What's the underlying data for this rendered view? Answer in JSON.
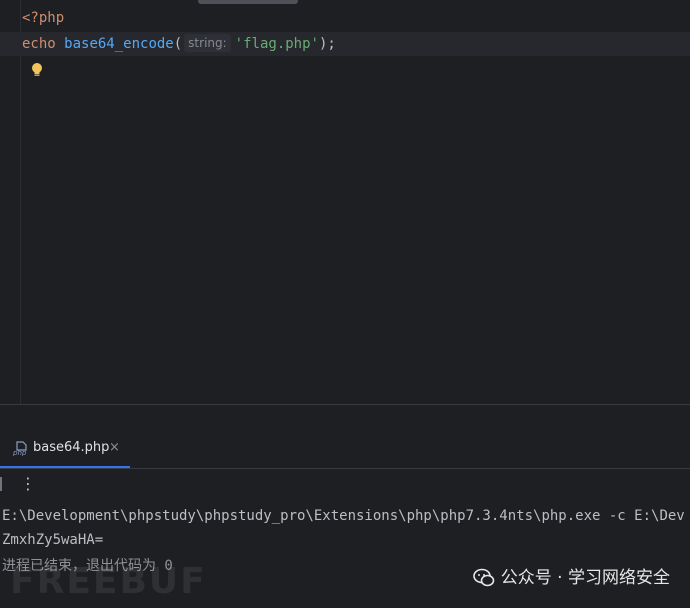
{
  "editor": {
    "line1": {
      "open_tag": "<?php"
    },
    "line2": {
      "keyword": "echo",
      "function": "base64_encode",
      "paren_open": "(",
      "param_hint": "string:",
      "argument": "'flag.php'",
      "paren_close": ");"
    },
    "intention_icon": "lightbulb-icon"
  },
  "run_panel": {
    "tab": {
      "icon": "php-file-icon",
      "label": "base64.php",
      "close": "×"
    },
    "toolbar": {
      "more": "⋮"
    },
    "console": {
      "command": "E:\\Development\\phpstudy\\phpstudy_pro\\Extensions\\php\\php7.3.4nts\\php.exe -c E:\\Dev",
      "output": "ZmxhZy5waHA=",
      "exit_message": "进程已结束，退出代码为 0"
    }
  },
  "watermark": {
    "site": "FREEBUF",
    "account": "公众号 · 学习网络安全"
  },
  "colors": {
    "background": "#1e1f22",
    "keyword": "#cf8e6d",
    "function": "#56a8f5",
    "string": "#6aab73",
    "accent": "#3574f0"
  }
}
